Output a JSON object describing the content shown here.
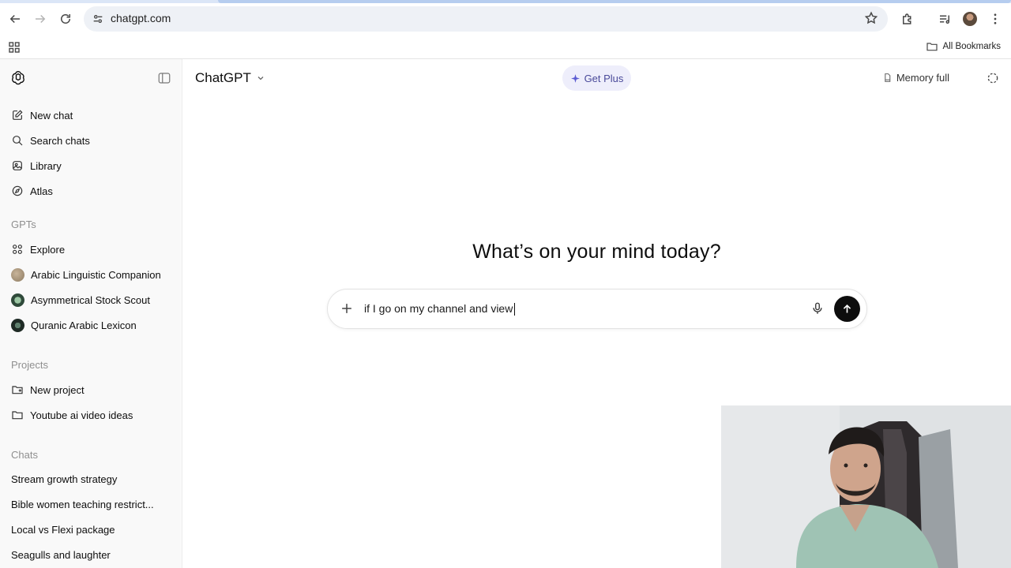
{
  "browser": {
    "url": "chatgpt.com",
    "bookmarks_all": "All Bookmarks",
    "icons": [
      "back-icon",
      "forward-icon",
      "reload-icon",
      "site-info-icon",
      "bookmark-star-icon",
      "extensions-icon",
      "media-icon",
      "profile-avatar",
      "menu-icon",
      "apps-grid-icon",
      "folder-icon"
    ]
  },
  "sidebar": {
    "nav": [
      {
        "label": "New chat",
        "icon": "compose-icon"
      },
      {
        "label": "Search chats",
        "icon": "search-icon"
      },
      {
        "label": "Library",
        "icon": "library-icon"
      },
      {
        "label": "Atlas",
        "icon": "atlas-icon"
      }
    ],
    "gpts_heading": "GPTs",
    "gpts": [
      {
        "label": "Explore",
        "icon": "explore-icon"
      },
      {
        "label": "Arabic Linguistic Companion",
        "icon": "gpt-avatar"
      },
      {
        "label": "Asymmetrical Stock Scout",
        "icon": "gpt-avatar"
      },
      {
        "label": "Quranic Arabic Lexicon",
        "icon": "gpt-avatar"
      }
    ],
    "projects_heading": "Projects",
    "projects": [
      {
        "label": "New project",
        "icon": "new-folder-icon"
      },
      {
        "label": "Youtube ai video ideas",
        "icon": "folder-icon"
      }
    ],
    "chats_heading": "Chats",
    "chats": [
      "Stream growth strategy",
      "Bible women teaching restrict...",
      "Local vs Flexi package",
      "Seagulls and laughter"
    ]
  },
  "header": {
    "model": "ChatGPT",
    "get_plus": "Get Plus",
    "memory": "Memory full"
  },
  "main": {
    "headline": "What’s on your mind today?",
    "composer_text": "if I go on my channel and view"
  },
  "colors": {
    "accent_plus": "#5a5ad2",
    "send_button": "#0d0d0d",
    "sidebar_bg": "#f9f9f9"
  }
}
